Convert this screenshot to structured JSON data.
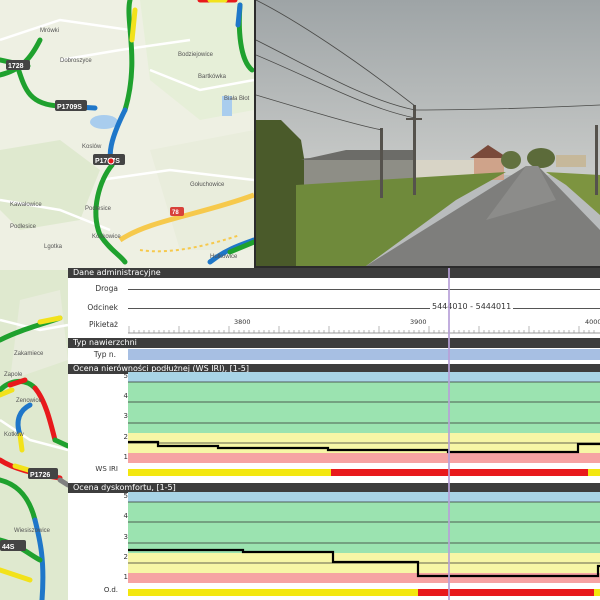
{
  "map": {
    "places": [
      {
        "id": "mrowki",
        "text": "Mrówki"
      },
      {
        "id": "dobroszyce",
        "text": "Dobroszyce"
      },
      {
        "id": "bodziejowice",
        "text": "Bodziejowice"
      },
      {
        "id": "bartkowka",
        "text": "Bartkówka"
      },
      {
        "id": "biala",
        "text": "Biała Błot"
      },
      {
        "id": "koslow",
        "text": "Koslów"
      },
      {
        "id": "goluchowice",
        "text": "Gołuchowice"
      },
      {
        "id": "kawalowice",
        "text": "Kawałowice"
      },
      {
        "id": "podlesice",
        "text": "Podlesice"
      },
      {
        "id": "podlesice2",
        "text": "Podlesice"
      },
      {
        "id": "lgotka",
        "text": "Lgotka"
      },
      {
        "id": "koskowice",
        "text": "Kośkowice"
      },
      {
        "id": "hulkowice",
        "text": "Hułkowice"
      },
      {
        "id": "zakamiece",
        "text": "Zakamiece"
      },
      {
        "id": "zapole",
        "text": "Zapole"
      },
      {
        "id": "zenowice",
        "text": "Zenowice"
      },
      {
        "id": "kotkow",
        "text": "Kotków"
      },
      {
        "id": "wiesiszowice",
        "text": "Wiesiszowice"
      }
    ],
    "road_badges": {
      "b1": "1728",
      "b2": "P1709S",
      "b3": "P1707S",
      "b4": "78",
      "b5": "P1726",
      "b6": "44S"
    }
  },
  "panel": {
    "admin_title": "Dane administracyjne",
    "droga_label": "Droga",
    "odcinek_label": "Odcinek",
    "odcinek_value": "5444010 - 5444011",
    "pikietaz_label": "Pikietaż",
    "pikietaz_ticks": [
      "3800",
      "3900",
      "4000"
    ],
    "surface_title": "Typ nawierzchni",
    "typ_label": "Typ n.",
    "iri_title": "Ocena nierówności podłużnej (WS IRI), [1-5]",
    "iri_levels": [
      "5",
      "4",
      "3",
      "2",
      "1"
    ],
    "iri_row_label": "WS IRI",
    "comfort_title": "Ocena dyskomfortu, [1-5]",
    "comfort_levels": [
      "5",
      "4",
      "3",
      "2",
      "1"
    ],
    "comfort_row_label": "O.d."
  },
  "colors": {
    "grade5": "#a8d4e6",
    "grade4": "#9be3b0",
    "grade3": "#9be3b0",
    "grade2": "#f7f6a6",
    "grade1": "#f6a3a3",
    "surface": "#a7bfe3",
    "bar_yellow": "#f3e70f",
    "bar_red": "#e8191c"
  }
}
